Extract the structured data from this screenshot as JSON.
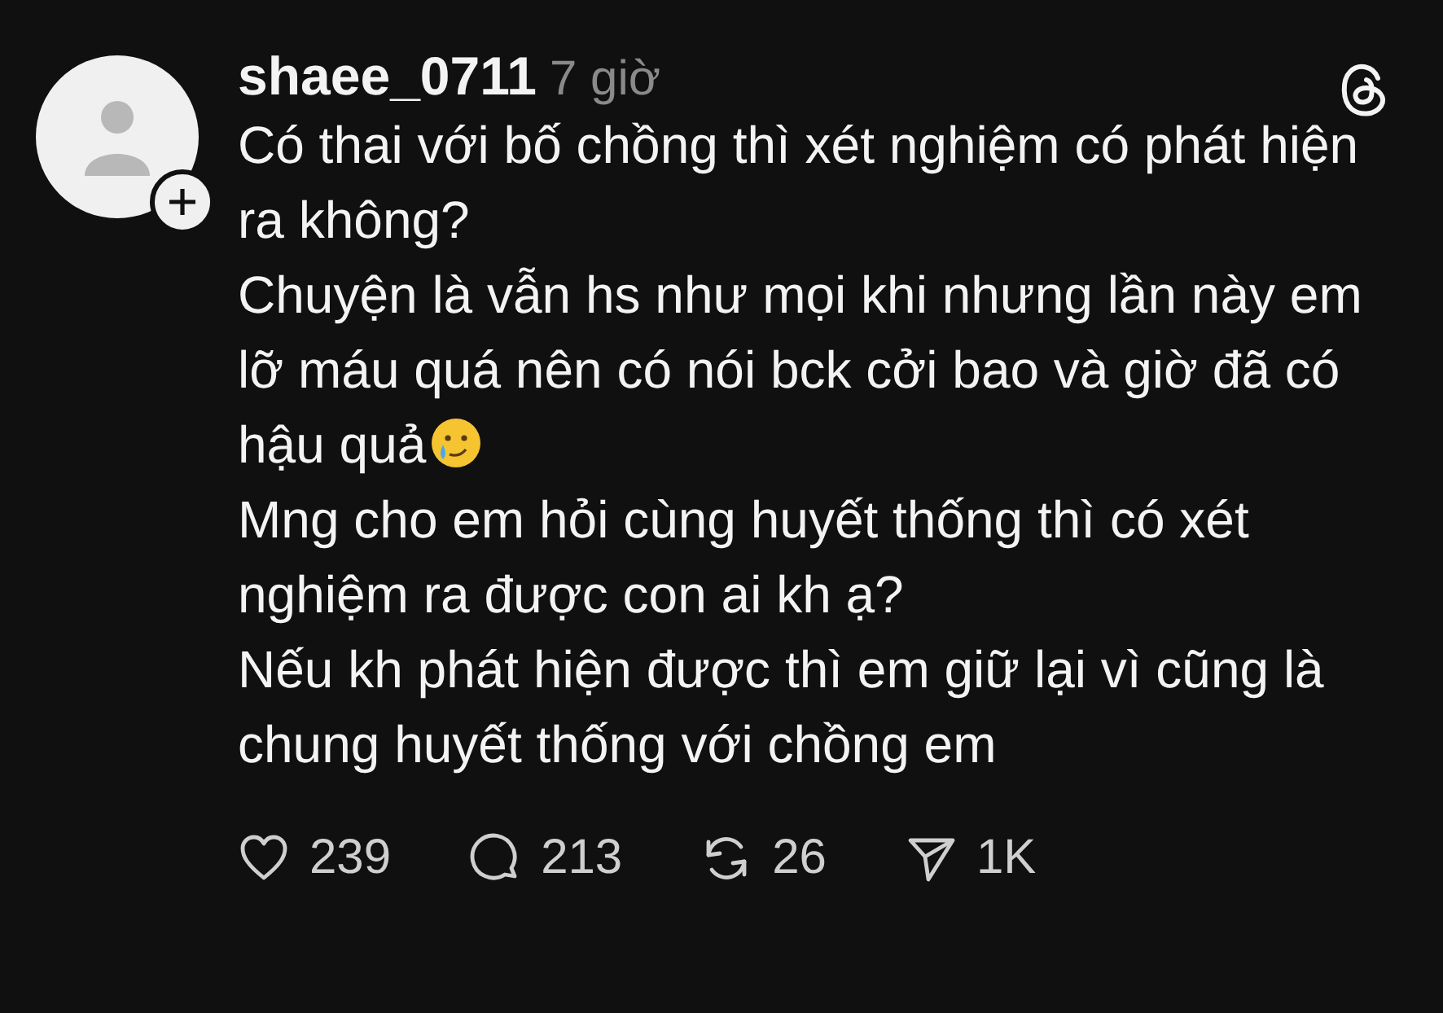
{
  "post": {
    "username": "shaee_0711",
    "time": "7 giờ",
    "paragraphs": [
      {
        "text": "Có thai với bố chồng thì xét nghiệm có phát hiện ra không?"
      },
      {
        "text": "Chuyện là vẫn hs như mọi khi nhưng lần này em lỡ máu quá nên có nói bck cởi bao và giờ đã có hậu quả",
        "emoji": true
      },
      {
        "text": "Mng cho em hỏi cùng huyết thống thì có xét nghiệm ra được con ai kh ạ?"
      },
      {
        "text": "Nếu kh phát hiện được thì em giữ lại vì cũng là chung huyết thống với chồng em"
      }
    ],
    "actions": [
      {
        "kind": "like",
        "count": "239"
      },
      {
        "kind": "reply",
        "count": "213"
      },
      {
        "kind": "repost",
        "count": "26"
      },
      {
        "kind": "share",
        "count": "1K"
      }
    ]
  }
}
